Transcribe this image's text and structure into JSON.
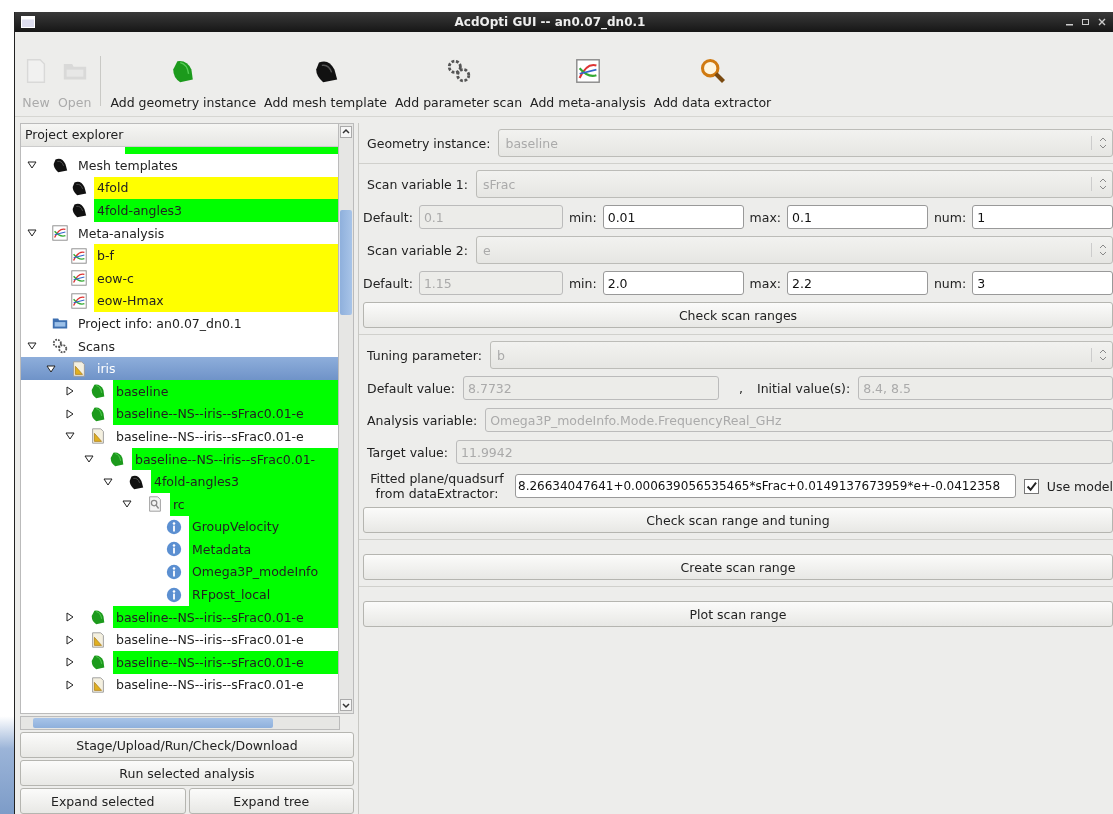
{
  "window": {
    "title": "AcdOpti GUI -- an0.07_dn0.1"
  },
  "toolbar": [
    {
      "label": "New",
      "kind": "new",
      "disabled": true
    },
    {
      "label": "Open",
      "kind": "open",
      "disabled": true
    },
    {
      "label": "Add geometry instance",
      "kind": "geometry",
      "disabled": false
    },
    {
      "label": "Add mesh template",
      "kind": "mesh",
      "disabled": false
    },
    {
      "label": "Add parameter scan",
      "kind": "gears",
      "disabled": false
    },
    {
      "label": "Add meta-analysis",
      "kind": "chart",
      "disabled": false
    },
    {
      "label": "Add data extractor",
      "kind": "magnifier",
      "disabled": false
    }
  ],
  "project_explorer": {
    "title": "Project explorer",
    "tree": [
      {
        "label": "Mesh templates",
        "kind": "mesh",
        "expandable": true,
        "expanded": true,
        "selected": false,
        "children": [
          {
            "label": "4fold",
            "kind": "mesh",
            "expandable": false,
            "selected": false,
            "color": "#ffff00"
          },
          {
            "label": "4fold-angles3",
            "kind": "mesh",
            "expandable": false,
            "selected": false,
            "color": "#00ff00"
          }
        ]
      },
      {
        "label": "Meta-analysis",
        "kind": "chart",
        "expandable": true,
        "expanded": true,
        "selected": false,
        "children": [
          {
            "label": "b-f",
            "kind": "chart",
            "expandable": false,
            "selected": false,
            "color": "#ffff00"
          },
          {
            "label": "eow-c",
            "kind": "chart",
            "expandable": false,
            "selected": false,
            "color": "#ffff00"
          },
          {
            "label": "eow-Hmax",
            "kind": "chart",
            "expandable": false,
            "selected": false,
            "color": "#ffff00"
          }
        ]
      },
      {
        "label": "Project info: an0.07_dn0.1",
        "kind": "folder",
        "expandable": false,
        "selected": false
      },
      {
        "label": "Scans",
        "kind": "gears",
        "expandable": true,
        "expanded": true,
        "selected": false,
        "children": [
          {
            "label": "iris",
            "kind": "doc",
            "expandable": true,
            "expanded": true,
            "selected": true,
            "children": [
              {
                "label": "baseline",
                "kind": "geometry",
                "expandable": true,
                "expanded": false,
                "selected": false,
                "color": "#00ff00"
              },
              {
                "label": "baseline--NS--iris--sFrac0.01-e",
                "kind": "geometry",
                "expandable": true,
                "expanded": false,
                "selected": false,
                "color": "#00ff00"
              },
              {
                "label": "baseline--NS--iris--sFrac0.01-e",
                "kind": "doc",
                "expandable": true,
                "expanded": true,
                "selected": false,
                "children": [
                  {
                    "label": "baseline--NS--iris--sFrac0.01-",
                    "kind": "geometry",
                    "expandable": true,
                    "expanded": true,
                    "selected": false,
                    "color": "#00ff00",
                    "children": [
                      {
                        "label": "4fold-angles3",
                        "kind": "mesh",
                        "expandable": true,
                        "expanded": true,
                        "selected": false,
                        "color": "#00ff00",
                        "children": [
                          {
                            "label": "rc",
                            "kind": "analysis",
                            "expandable": true,
                            "expanded": true,
                            "selected": false,
                            "color": "#00ff00",
                            "children": [
                              {
                                "label": "GroupVelocity",
                                "kind": "info",
                                "expandable": false,
                                "selected": false,
                                "color": "#00ff00"
                              },
                              {
                                "label": "Metadata",
                                "kind": "info",
                                "expandable": false,
                                "selected": false,
                                "color": "#00ff00"
                              },
                              {
                                "label": "Omega3P_modeInfo",
                                "kind": "info",
                                "expandable": false,
                                "selected": false,
                                "color": "#00ff00"
                              },
                              {
                                "label": "RFpost_local",
                                "kind": "info",
                                "expandable": false,
                                "selected": false,
                                "color": "#00ff00"
                              }
                            ]
                          }
                        ]
                      }
                    ]
                  }
                ]
              },
              {
                "label": "baseline--NS--iris--sFrac0.01-e",
                "kind": "geometry",
                "expandable": true,
                "expanded": false,
                "selected": false,
                "color": "#00ff00"
              },
              {
                "label": "baseline--NS--iris--sFrac0.01-e",
                "kind": "doc",
                "expandable": true,
                "expanded": false,
                "selected": false
              },
              {
                "label": "baseline--NS--iris--sFrac0.01-e",
                "kind": "geometry",
                "expandable": true,
                "expanded": false,
                "selected": false,
                "color": "#00ff00"
              },
              {
                "label": "baseline--NS--iris--sFrac0.01-e",
                "kind": "doc",
                "expandable": true,
                "expanded": false,
                "selected": false
              }
            ]
          }
        ]
      }
    ]
  },
  "actions": [
    "Stage/Upload/Run/Check/Download",
    "Run selected analysis"
  ],
  "expand_buttons": [
    "Expand selected",
    "Expand tree"
  ],
  "geometry": {
    "label": "Geometry instance:",
    "value": "baseline"
  },
  "scan_variables": [
    {
      "label": "Scan variable 1:",
      "value": "sFrac",
      "default_label": "Default:",
      "default": "0.1",
      "min_label": "min:",
      "min": "0.01",
      "max_label": "max:",
      "max": "0.1",
      "num_label": "num:",
      "num": "1"
    },
    {
      "label": "Scan variable 2:",
      "value": "e",
      "default_label": "Default:",
      "default": "1.15",
      "min_label": "min:",
      "min": "2.0",
      "max_label": "max:",
      "max": "2.2",
      "num_label": "num:",
      "num": "3"
    }
  ],
  "check_ranges_button": "Check scan ranges",
  "tuning": {
    "parameter_label": "Tuning parameter:",
    "parameter": "b",
    "default_label": "Default value:",
    "default": "8.7732",
    "separator": ",",
    "initial_label": "Initial value(s):",
    "initial": "8.4, 8.5",
    "analysis_label": "Analysis variable:",
    "analysis": "Omega3P_modeInfo.Mode.FrequencyReal_GHz",
    "target_label": "Target value:",
    "target": "11.9942",
    "fit_label": "Fitted plane/quadsurf from dataExtractor:",
    "fit": "8.26634047641+0.000639056535465*sFrac+0.0149137673959*e+-0.0412358",
    "use_model_label": "Use model",
    "use_model": true
  },
  "check_tuning_button": "Check scan range and tuning",
  "create_button": "Create scan range",
  "plot_button": "Plot scan range"
}
